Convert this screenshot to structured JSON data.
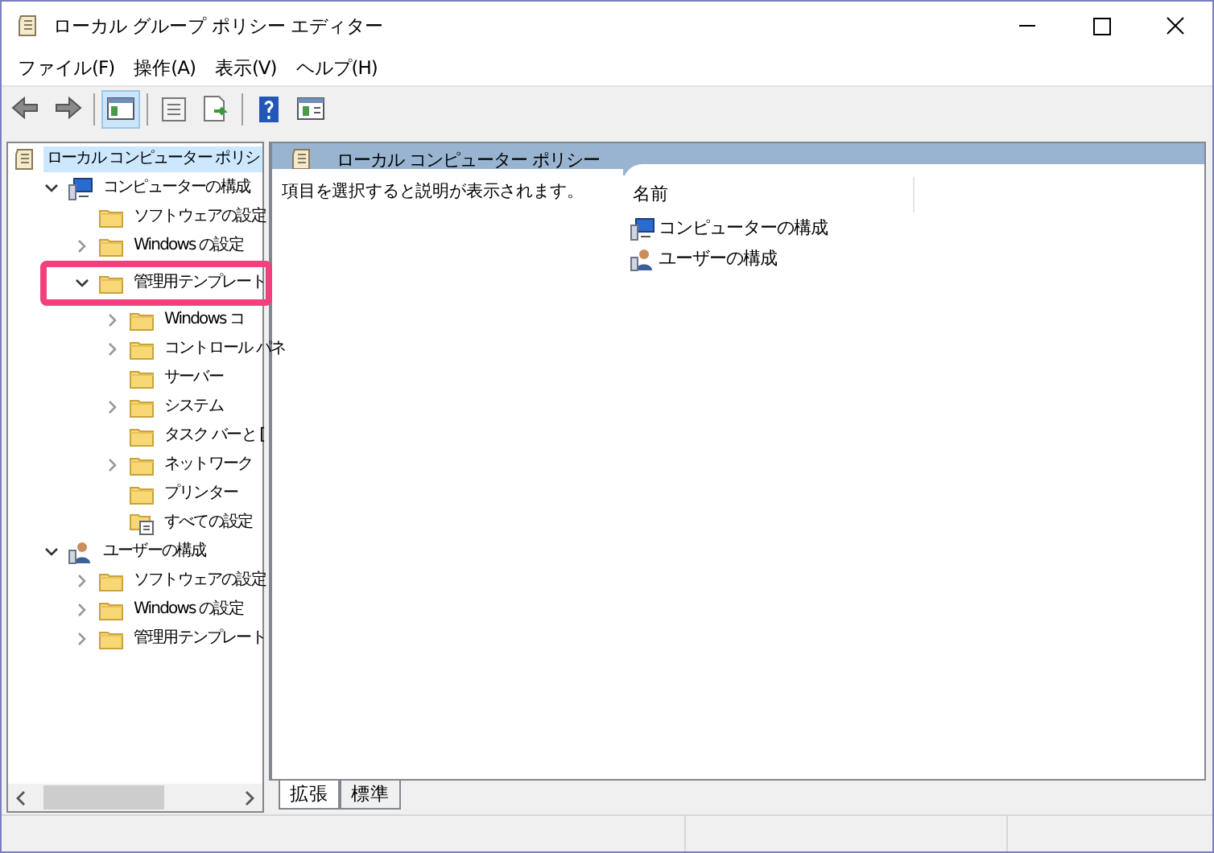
{
  "window": {
    "title": "ローカル グループ ポリシー エディター"
  },
  "menu": [
    "ファイル(F)",
    "操作(A)",
    "表示(V)",
    "ヘルプ(H)"
  ],
  "toolbar": [
    {
      "kind": "back",
      "enabled": true
    },
    {
      "kind": "forward",
      "enabled": true
    },
    {
      "kind": "sep"
    },
    {
      "kind": "tree",
      "selected": true
    },
    {
      "kind": "sep"
    },
    {
      "kind": "props",
      "selected": false
    },
    {
      "kind": "export",
      "selected": false
    },
    {
      "kind": "sep"
    },
    {
      "kind": "help",
      "selected": false
    },
    {
      "kind": "panel",
      "selected": false
    }
  ],
  "tree": [
    {
      "label": "ローカル コンピューター ポリシ",
      "kind": "policy",
      "selected": true,
      "children": [
        {
          "label": "コンピューターの構成",
          "kind": "computer",
          "expanded": true,
          "selected": false,
          "children": [
            {
              "label": "ソフトウェアの設定",
              "kind": "folder",
              "selected": false
            },
            {
              "label": "Windows の設定",
              "kind": "folder",
              "expanded": false,
              "selected": false
            },
            {
              "label": "管理用テンプレート",
              "kind": "folder",
              "expanded": true,
              "selected": false,
              "highlighted": true,
              "children": [
                {
                  "label": "Windows コ",
                  "kind": "folder",
                  "expanded": false,
                  "selected": false
                },
                {
                  "label": "コントロール パネ",
                  "kind": "folder",
                  "expanded": false,
                  "selected": false
                },
                {
                  "label": "サーバー",
                  "kind": "folder",
                  "selected": false
                },
                {
                  "label": "システム",
                  "kind": "folder",
                  "expanded": false,
                  "selected": false
                },
                {
                  "label": "タスク バーと [",
                  "kind": "folder",
                  "selected": false
                },
                {
                  "label": "ネットワーク",
                  "kind": "folder",
                  "expanded": false,
                  "selected": false
                },
                {
                  "label": "プリンター",
                  "kind": "folder",
                  "selected": false
                },
                {
                  "label": "すべての設定",
                  "kind": "settings",
                  "selected": false
                }
              ]
            }
          ]
        },
        {
          "label": "ユーザーの構成",
          "kind": "user",
          "expanded": true,
          "selected": false,
          "children": [
            {
              "label": "ソフトウェアの設定",
              "kind": "folder",
              "expanded": false,
              "selected": false
            },
            {
              "label": "Windows の設定",
              "kind": "folder",
              "expanded": false,
              "selected": false
            },
            {
              "label": "管理用テンプレート",
              "kind": "folder",
              "expanded": false,
              "selected": false
            }
          ]
        }
      ]
    }
  ],
  "detail": {
    "header": "ローカル コンピューター ポリシー",
    "description": "項目を選択すると説明が表示されます。",
    "column": "名前",
    "items": [
      {
        "label": "コンピューターの構成",
        "kind": "computer"
      },
      {
        "label": "ユーザーの構成",
        "kind": "user"
      }
    ]
  },
  "tabs": [
    {
      "label": "拡張",
      "selected": true
    },
    {
      "label": "標準",
      "selected": false
    }
  ]
}
